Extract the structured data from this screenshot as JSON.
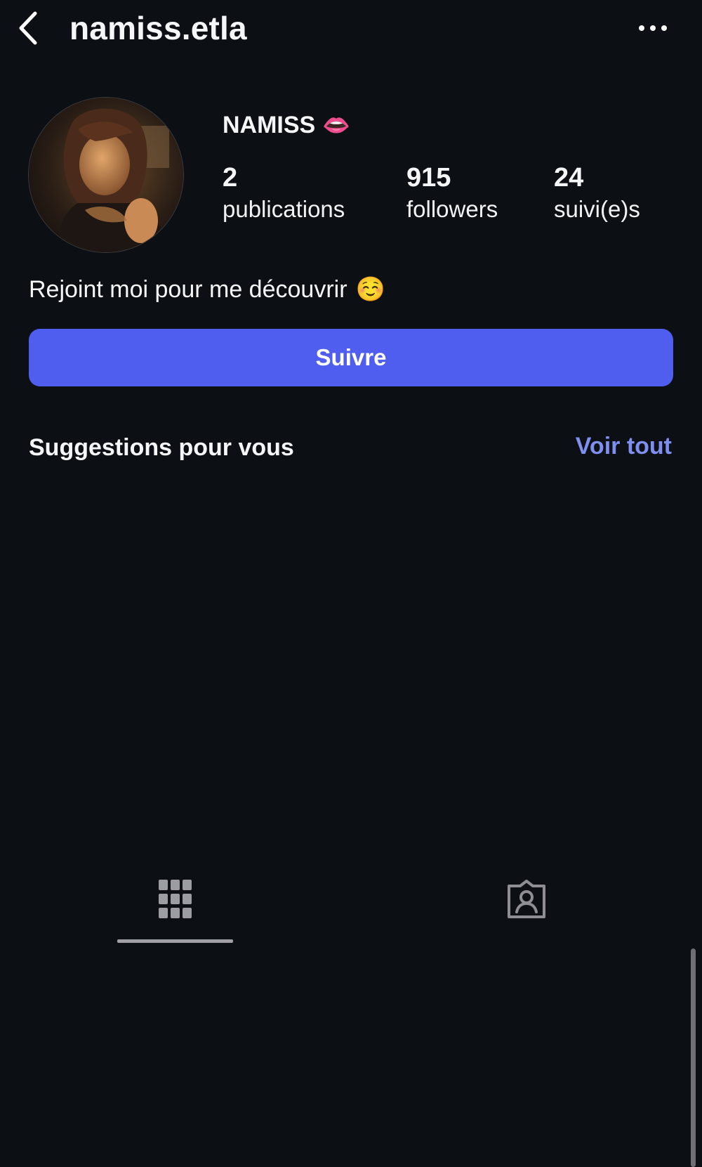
{
  "header": {
    "username": "namiss.etla",
    "back_icon": "chevron-left-icon",
    "more_icon": "ellipsis-icon"
  },
  "profile": {
    "display_name": "NAMISS",
    "name_emoji": "👄",
    "stats": [
      {
        "value": "2",
        "label": "publications"
      },
      {
        "value": "915",
        "label": "followers"
      },
      {
        "value": "24",
        "label": "suivi(e)s"
      }
    ],
    "bio_text": "Rejoint moi pour me découvrir",
    "bio_emoji": "☺️"
  },
  "actions": {
    "follow_label": "Suivre"
  },
  "suggestions": {
    "title": "Suggestions pour vous",
    "see_all_label": "Voir tout"
  },
  "tabs": [
    {
      "name": "posts-grid",
      "icon": "grid-icon",
      "selected": true
    },
    {
      "name": "tagged",
      "icon": "tagged-person-icon",
      "selected": false
    }
  ],
  "colors": {
    "background": "#0c0f14",
    "accent_button": "#4f5eee",
    "link": "#7e8ff0"
  }
}
